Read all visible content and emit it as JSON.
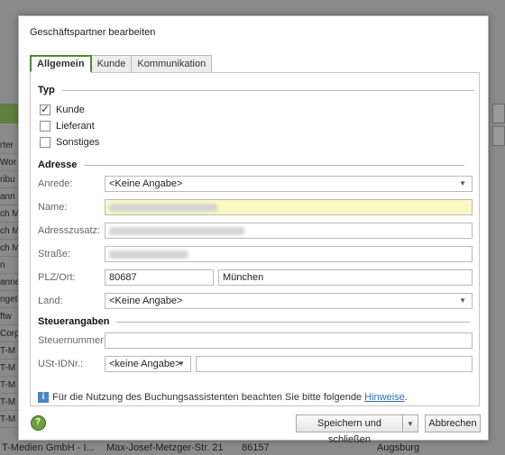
{
  "background": {
    "rows": [
      "rter",
      "Wor",
      "ribu",
      "ann",
      "ch M",
      "ch M",
      "ch M",
      "n",
      "anne",
      "nget",
      "ftw",
      "Corp",
      "T-M",
      "T-M",
      "T-M",
      "T-M",
      "T-M"
    ],
    "bottom_row": {
      "company": "T-Medien GmbH - I...",
      "street": "Max-Josef-Metzger-Str. 21",
      "zip": "86157",
      "city": "Augsburg"
    }
  },
  "dialog": {
    "title": "Geschäftspartner bearbeiten",
    "tabs": [
      {
        "label": "Allgemein",
        "active": true
      },
      {
        "label": "Kunde",
        "active": false
      },
      {
        "label": "Kommunikation",
        "active": false
      }
    ],
    "typ": {
      "heading": "Typ",
      "options": [
        {
          "label": "Kunde",
          "checked": true
        },
        {
          "label": "Lieferant",
          "checked": false
        },
        {
          "label": "Sonstiges",
          "checked": false
        }
      ]
    },
    "adresse": {
      "heading": "Adresse",
      "anrede_label": "Anrede:",
      "anrede_value": "<Keine Angabe>",
      "name_label": "Name:",
      "adresszusatz_label": "Adresszusatz:",
      "strasse_label": "Straße:",
      "plz_ort_label": "PLZ/Ort:",
      "plz_value": "80687",
      "ort_value": "München",
      "land_label": "Land:",
      "land_value": "<Keine Angabe>"
    },
    "steuer": {
      "heading": "Steuerangaben",
      "steuernummer_label": "Steuernummer:",
      "steuernummer_value": "",
      "ustid_label": "USt-IDNr.:",
      "ustid_prefix": "<keine Angabe>",
      "ustid_value": ""
    },
    "info": {
      "text_before": "Für die Nutzung des Buchungsassistenten beachten Sie bitte folgende ",
      "link": "Hinweise",
      "text_after": "."
    },
    "buttons": {
      "save_close": "Speichern und schließen",
      "cancel": "Abbrechen"
    }
  }
}
